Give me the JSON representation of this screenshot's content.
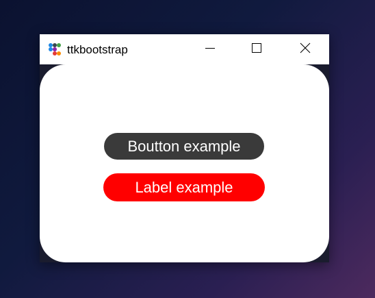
{
  "window": {
    "title": "ttkbootstrap",
    "icon": "ttkbootstrap-logo-icon",
    "controls": {
      "minimize": "minimize-icon",
      "maximize": "maximize-icon",
      "close": "close-icon"
    }
  },
  "content": {
    "button_label": "Boutton example",
    "label_text": "Label example"
  },
  "colors": {
    "button_bg": "#3a3a3a",
    "label_bg": "#ff0000",
    "text": "#ffffff",
    "client_bg": "#ffffff"
  }
}
